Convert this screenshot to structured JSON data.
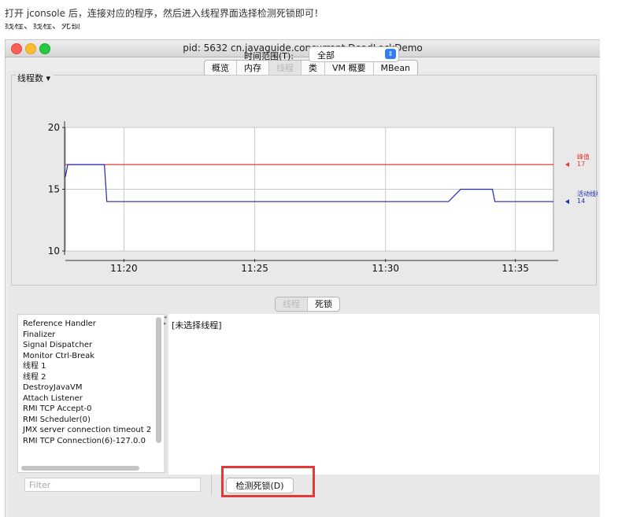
{
  "caption": "打开 jconsole 后，连接对应的程序，然后进入线程界面选择检测死锁即可！",
  "cut_text": "线程、线程、死锁",
  "window": {
    "title": "pid: 5632 cn.javaguide.concurrent.DeadLockDemo"
  },
  "tabs": [
    {
      "label": "概览"
    },
    {
      "label": "内存"
    },
    {
      "label": "线程",
      "active": true
    },
    {
      "label": "类"
    },
    {
      "label": "VM 概要"
    },
    {
      "label": "MBean"
    }
  ],
  "time_range": {
    "label": "时间范围(T):",
    "value": "全部"
  },
  "chart_title": "线程数 ▾",
  "chart_data": {
    "type": "line",
    "x_ticks": [
      "11:20",
      "11:25",
      "11:30",
      "11:35"
    ],
    "y_ticks": [
      10,
      15,
      20
    ],
    "ylim": [
      10,
      20
    ],
    "grid": true,
    "series": [
      {
        "name": "峰值",
        "color": "#e53935",
        "points": [
          [
            0.0,
            17
          ],
          [
            1.0,
            17
          ]
        ],
        "latest": 17
      },
      {
        "name": "活动线程",
        "color": "#1e2bb8",
        "points": [
          [
            0.0,
            16
          ],
          [
            0.005,
            17
          ],
          [
            0.08,
            17
          ],
          [
            0.085,
            14
          ],
          [
            0.785,
            14
          ],
          [
            0.81,
            15
          ],
          [
            0.875,
            15
          ],
          [
            0.88,
            14
          ],
          [
            1.0,
            14
          ]
        ],
        "latest": 14
      }
    ]
  },
  "lower_tabs": [
    {
      "label": "线程",
      "active": true
    },
    {
      "label": "死锁"
    }
  ],
  "thread_list": [
    "Reference Handler",
    "Finalizer",
    "Signal Dispatcher",
    "Monitor Ctrl-Break",
    "线程 1",
    "线程 2",
    "DestroyJavaVM",
    "Attach Listener",
    "RMI TCP Accept-0",
    "RMI Scheduler(0)",
    "JMX server connection timeout 2",
    "RMI TCP Connection(6)-127.0.0"
  ],
  "detail_text": "[未选择线程]",
  "filter_placeholder": "Filter",
  "detect_button": "检测死锁(D)"
}
